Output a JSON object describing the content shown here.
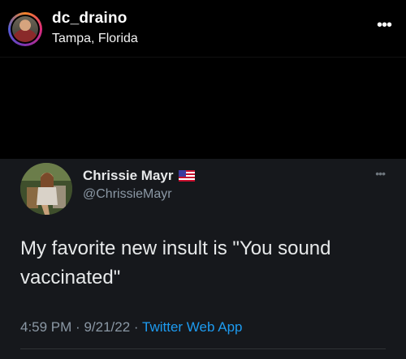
{
  "post_header": {
    "username": "dc_draino",
    "location": "Tampa, Florida",
    "more_icon": "more-dots-icon"
  },
  "tweet": {
    "display_name": "Chrissie Mayr",
    "flag_icon": "us-flag-icon",
    "handle": "@ChrissieMayr",
    "text": "My favorite new insult is \"You sound vaccinated\"",
    "time": "4:59 PM",
    "date": "9/21/22",
    "separator": "·",
    "source": "Twitter Web App",
    "more_icon": "more-dots-icon"
  },
  "colors": {
    "background": "#000000",
    "tweet_background": "#16181c",
    "link_blue": "#1d9bf0",
    "secondary_text": "#8b98a5"
  }
}
